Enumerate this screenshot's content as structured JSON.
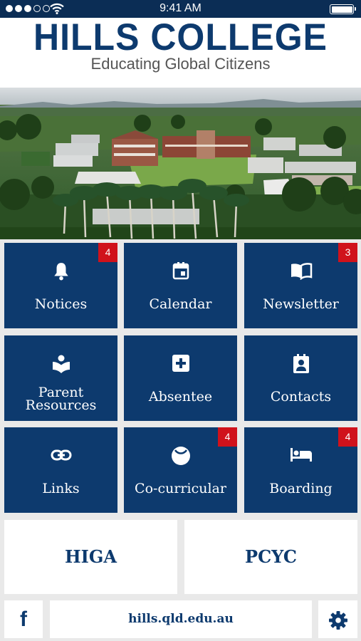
{
  "status_bar": {
    "time": "9:41 AM"
  },
  "header": {
    "title": "HILLS COLLEGE",
    "tagline": "Educating Global Citizens"
  },
  "tiles": [
    {
      "label": "Notices",
      "icon": "bell-icon",
      "badge": "4"
    },
    {
      "label": "Calendar",
      "icon": "calendar-icon",
      "badge": ""
    },
    {
      "label": "Newsletter",
      "icon": "book-icon",
      "badge": "3"
    },
    {
      "label_line1": "Parent",
      "label_line2": "Resources",
      "icon": "reading-person-icon",
      "badge": ""
    },
    {
      "label": "Absentee",
      "icon": "plus-box-icon",
      "badge": ""
    },
    {
      "label": "Contacts",
      "icon": "contact-card-icon",
      "badge": ""
    },
    {
      "label": "Links",
      "icon": "link-icon",
      "badge": ""
    },
    {
      "label": "Co-curricular",
      "icon": "ball-icon",
      "badge": "4"
    },
    {
      "label": "Boarding",
      "icon": "bed-icon",
      "badge": "4"
    }
  ],
  "quick_links": [
    {
      "label": "HIGA"
    },
    {
      "label": "PCYC"
    }
  ],
  "footer": {
    "facebook_label": "f",
    "url": "hills.qld.edu.au",
    "settings_icon": "gear-icon"
  },
  "colors": {
    "primary": "#0d3a6e",
    "badge": "#d0121b",
    "status_bar": "#0b2d55",
    "background": "#e9e9e9"
  }
}
